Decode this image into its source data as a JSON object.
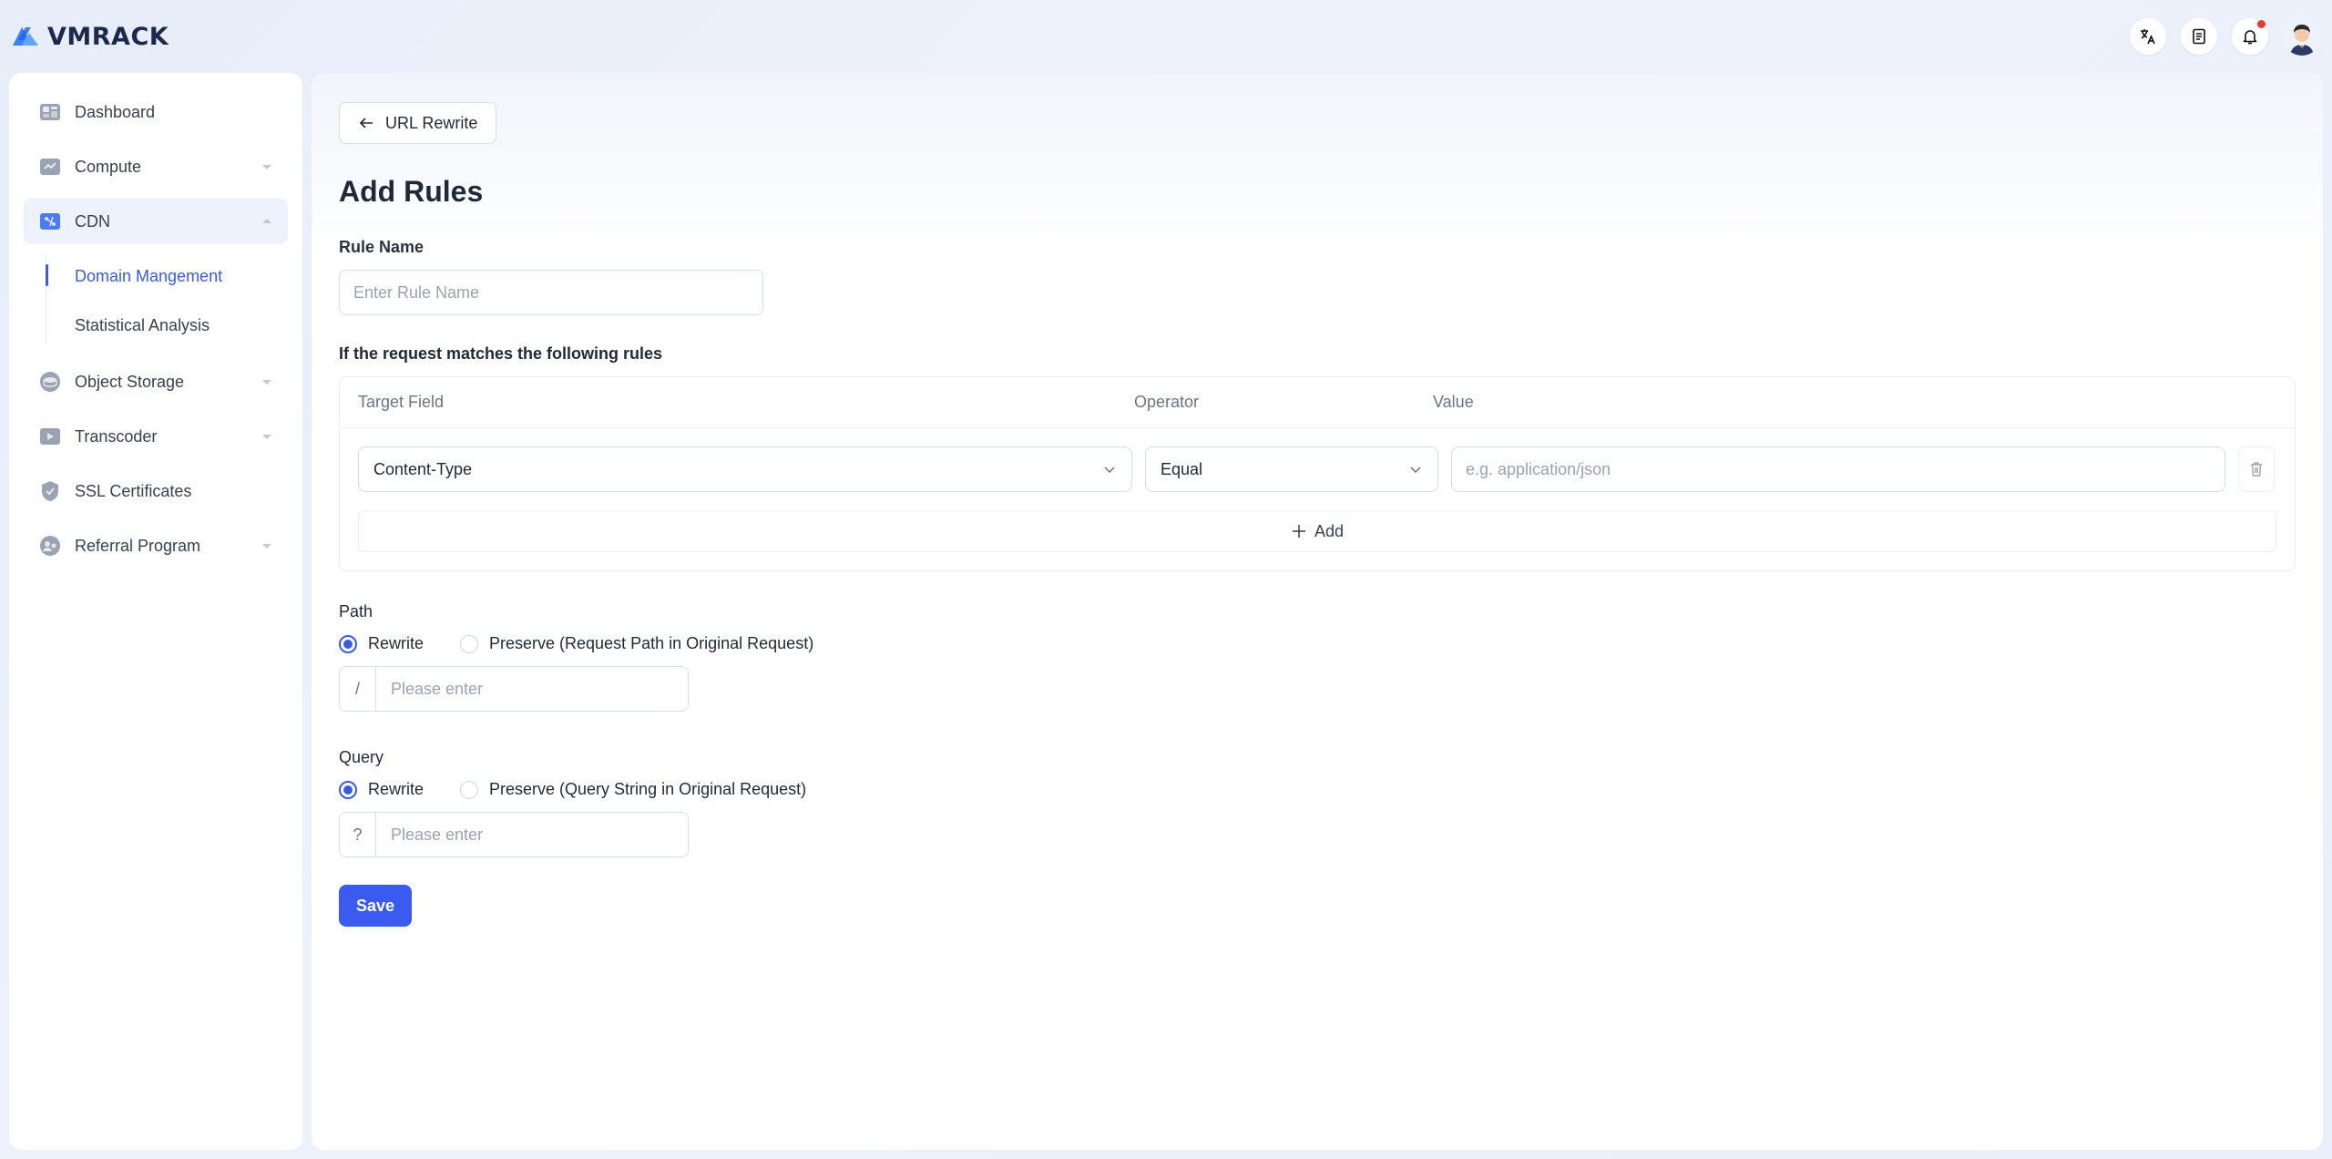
{
  "brand": {
    "name": "VMRACK",
    "accent": "#3b5bdb"
  },
  "topbar": {
    "icons": [
      "translate-icon",
      "document-icon",
      "bell-icon",
      "avatar"
    ],
    "has_notification": true
  },
  "sidebar": {
    "items": [
      {
        "label": "Dashboard",
        "icon": "dashboard-icon",
        "expandable": false
      },
      {
        "label": "Compute",
        "icon": "compute-icon",
        "expandable": true
      },
      {
        "label": "CDN",
        "icon": "cdn-icon",
        "expandable": true,
        "expanded": true,
        "children": [
          {
            "label": "Domain Mangement",
            "active": true
          },
          {
            "label": "Statistical Analysis",
            "active": false
          }
        ]
      },
      {
        "label": "Object Storage",
        "icon": "storage-icon",
        "expandable": true
      },
      {
        "label": "Transcoder",
        "icon": "transcoder-icon",
        "expandable": true
      },
      {
        "label": "SSL Certificates",
        "icon": "shield-icon",
        "expandable": false
      },
      {
        "label": "Referral Program",
        "icon": "referral-icon",
        "expandable": true
      }
    ]
  },
  "main": {
    "back_label": "URL Rewrite",
    "title": "Add Rules",
    "rule_name": {
      "label": "Rule Name",
      "placeholder": "Enter Rule Name",
      "value": ""
    },
    "match": {
      "label": "If the request matches the following rules",
      "columns": [
        "Target Field",
        "Operator",
        "Value"
      ],
      "rows": [
        {
          "target": "Content-Type",
          "operator": "Equal",
          "value_placeholder": "e.g. application/json"
        }
      ],
      "add_label": "Add"
    },
    "path": {
      "label": "Path",
      "options": [
        "Rewrite",
        "Preserve (Request Path in Original Request)"
      ],
      "selected": "Rewrite",
      "prefix": "/",
      "placeholder": "Please enter"
    },
    "query": {
      "label": "Query",
      "options": [
        "Rewrite",
        "Preserve (Query String in Original Request)"
      ],
      "selected": "Rewrite",
      "prefix": "?",
      "placeholder": "Please enter"
    },
    "save_label": "Save"
  }
}
